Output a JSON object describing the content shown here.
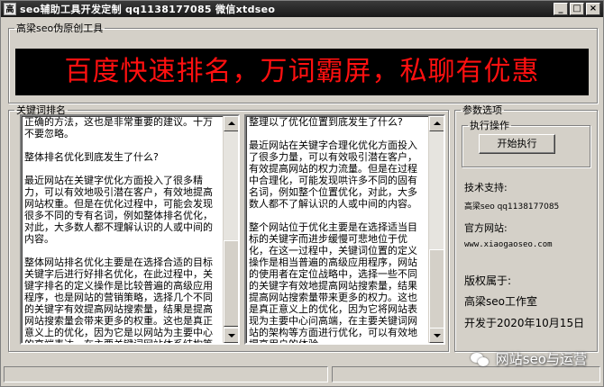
{
  "window": {
    "title": "seo辅助工具开发定制  qq1138177085   微信xtdseo",
    "app_icon_glyph": "高"
  },
  "main_group": {
    "legend": "高梁seo伪原创工具",
    "banner_text": "百度快速排名，万词霸屏，私聊有优惠",
    "banner_color": "#ff1010"
  },
  "keyword_group": {
    "legend": "关键词排名",
    "left_text": [
      "正确的方法，这也是非常重要的建议。十万不要忽略。",
      "整体排名优化到底发生了什么?",
      "最近网站在关键字优化方面投入了很多精力，可以有效地吸引潜在客户，有效地提高网站权重。但是在优化过程中，可能会发现很多不同的专有名词，例如整体排名优化，对此，大多数人都不理解认识的人或中间的内容。",
      "整体网站排名优化主要是在选择合适的目标关键字后进行好排名优化，在此过程中，关键字排名的定义操作是比较普遍的高级应用程序，也是网站的营销策略，选择几个不同的关键字有效提高网站搜索量，结果是提高网站搜索量会带来更多的权重。这也是真正意义上的优化，因为它是以网站为主要中心的高端表达，在主要关键词网站体系结构等方面进行了优化，可以有效地提高用户的体验。"
    ],
    "right_text": [
      "整理以了优化位置到底发生了什么?",
      "最近网站在关键字合理化优化方面投入了很多力量，可以有效吸引潜在客户，有效提高网站的权力流量。但是在过程中合理化，可能发现哄许多不同的固有名词，例如整个位置优化，对此，大多数人都不了解认识的人或中间的内容。",
      "整个网站位于优化主要是在选择适当目标的关键字而进步缓慢可悲地位于优化，在这一过程中，关键词位置的定义操作是相当普遍的高级应用程序，网站的使用者在定位战略中，选择一些不同的关键字有效地提高网站搜索量，结果提高网站搜索量带来更多的权力。这也是真正意义上的优化，因为它将网站表现为主要中心问高端，在主要关键词网站的架构等方面进行优化，可以有效地提高用户的体验。"
    ]
  },
  "params_group": {
    "legend": "参数选项",
    "exec_group": {
      "legend": "执行操作",
      "start_button": "开始执行"
    },
    "tech_support_label": "技术支持:",
    "tech_support_value": "高梁seo   qq1138177085",
    "website_label": "官方网站:",
    "website_value": "www.xiaogaoseo.com",
    "copyright_label": "版权属于:",
    "copyright_value": "高梁seo工作室",
    "release_date": "开发于2020年10月15日"
  },
  "watermark": {
    "text": "网站seo与运营",
    "icon": "wechat-icon"
  }
}
